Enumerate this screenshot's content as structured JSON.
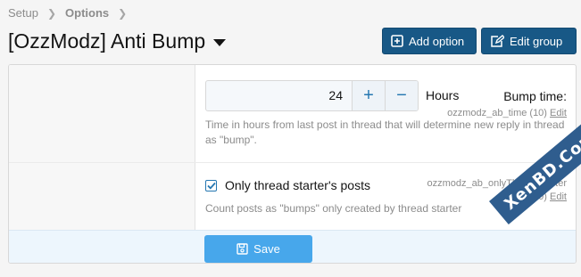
{
  "breadcrumb": {
    "items": [
      "Setup",
      "Options"
    ]
  },
  "page": {
    "title": "[OzzModz] Anti Bump"
  },
  "header_actions": {
    "add_option": "Add option",
    "edit_group": "Edit group"
  },
  "options": [
    {
      "label": "Bump time:",
      "meta": "ozzmodz_ab_time (10)",
      "edit": "Edit",
      "value": "24",
      "units": "Hours",
      "explain": "Time in hours from last post in thread that will determine new reply in thread as \"bump\"."
    },
    {
      "meta_line1": "ozzmodz_ab_onlyThreadStarter",
      "meta_line2": "(20)",
      "edit": "Edit",
      "checkbox_label": "Only thread starter's posts",
      "checked": true,
      "explain": "Count posts as \"bumps\" only created by thread starter"
    }
  ],
  "form": {
    "save_label": "Save"
  },
  "colors": {
    "primary": "#185886",
    "save": "#47a7eb",
    "link": "#2577b1"
  },
  "watermark": {
    "text": "XenBD.Com"
  }
}
